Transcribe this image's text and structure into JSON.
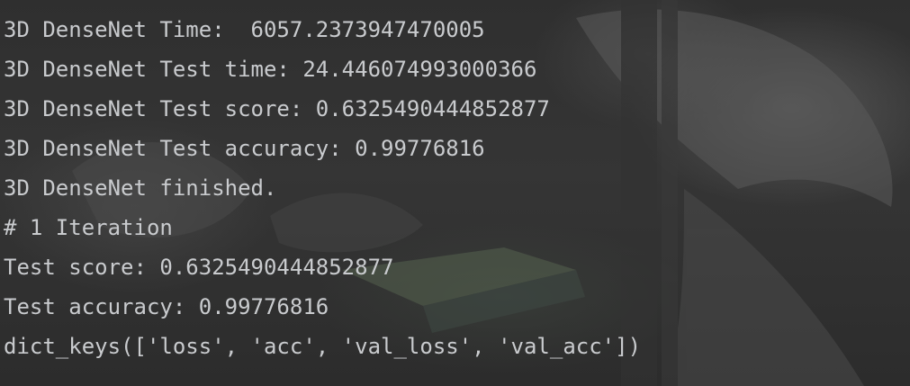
{
  "console": {
    "lines": [
      "3D DenseNet Time:  6057.2373947470005",
      "3D DenseNet Test time: 24.446074993000366",
      "3D DenseNet Test score: 0.6325490444852877",
      "3D DenseNet Test accuracy: 0.99776816",
      "3D DenseNet finished.",
      "# 1 Iteration",
      "Test score: 0.6325490444852877",
      "Test accuracy: 0.99776816",
      "dict_keys(['loss', 'acc', 'val_loss', 'val_acc'])"
    ]
  },
  "colors": {
    "text": "#c9cbce",
    "background": "#2f2f2f"
  }
}
